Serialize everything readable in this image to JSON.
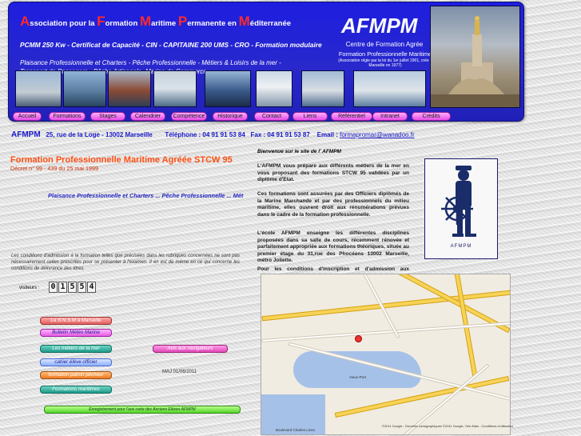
{
  "header": {
    "title_parts": [
      {
        "cap": "A",
        "rest": "ssociation pour la "
      },
      {
        "cap": "F",
        "rest": "ormation "
      },
      {
        "cap": "M",
        "rest": "aritime "
      },
      {
        "cap": "P",
        "rest": "ermanente en "
      },
      {
        "cap": "M",
        "rest": "éditerranée"
      }
    ],
    "subline": "PCMM 250 Kw - Certificat de Capacité - CIN - CAPITAINE 200 UMS - CRO - Formation modulaire",
    "sectors": "Plaisance Professionnelle et Charters - Pêche Professionnelle - Métiers & Loisirs de la mer - Transport de Passagers - Pêche Artisanale- Marine de Commerce",
    "brand": "AFMPM",
    "centre_line1": "Centre de Formation Agrée",
    "centre_line2": "Formation Professionnelle Maritime",
    "centre_line3": "(Association régie par la loi du 1er juillet 1901, crée à Marseille en 1977)"
  },
  "nav": [
    {
      "label": "Accueil"
    },
    {
      "label": "Formations"
    },
    {
      "label": "Stages"
    },
    {
      "label": "Calendrier"
    },
    {
      "label": "Compétence"
    },
    {
      "label": "Historique"
    },
    {
      "label": "Contact"
    },
    {
      "label": "Liens"
    },
    {
      "label": "Référentiel"
    },
    {
      "label": "Intranet"
    },
    {
      "label": "Crédits"
    }
  ],
  "contact": {
    "name": "AFMPM",
    "address": "25, rue de la Loge - 13002 Marseille",
    "phone": "Téléphone : 04 91 91 53 84",
    "fax": "Fax : 04 91 91 53 87",
    "email_label": "Email :",
    "email": "formapromar@wanadoo.fr"
  },
  "left": {
    "formation_title": "Formation Professionnelle Maritime Agréée STCW 95",
    "decret": "Décret n° 99 - 439 du 25 mai 1999",
    "marquee": "Plaisance Professionnelle et Charters ... Pêche Professionnelle ... Mét",
    "conditions": "Les conditions d'admission à la formation telles que précisées dans les rubriques concernées ne sont pas nécessairement celles prescrites pour se présenter à l'examen. Il en est de même en ce qui concerne les conditions de délivrance des titres.",
    "visitors_label": "visiteurs :",
    "visitor_digits": [
      "0",
      "1",
      "5",
      "5",
      "4"
    ],
    "links": [
      "La S.N.S.M à Marseille",
      "Bulletin Météo Marine",
      "Les métiers de la mer",
      "cahier élève officier",
      "formation patron pêcheur",
      "Formations maritimes",
      "Avis aux navigateurs",
      "Enregistrement pour l'ave carte des Anciens Elèves AFMPM"
    ],
    "maj": "MAJ 01/06/2011"
  },
  "right": {
    "welcome": "Bienvenue sur le site de l' AFMPM",
    "para1": "L'AFMPM vous prépare aux différents métiers de la mer en vous proposant des formations STCW 95 validées par un diplôme d'Etat.",
    "para2": "Ces formations sont assurées par des Officiers diplômés de la Marine Marchande et par des professionnels du milieu maritime, elles ouvrent droit aux rénumérations prévues dans le cadre de la formation professionnelle.",
    "para3": "L'école AFMPM enseigne les différentes disciplines proposées dans sa salle de cours, récemment rénovée et parfaitement appropriée aux formations théoriques, située au premier étage du 31,rue des Phocéens 13002 Marseille, métro Joliette.",
    "para4": "Pour les conditions d'inscription et d'admission aux formations, veuillez consulter la page Formations.",
    "logo_text": "AFMPM",
    "map_footer": "©2011 Google - Données cartographiques ©2011 Google, Tele Atlas - Conditions d'utilisation",
    "map_label_street": "Boulevard Charles Livon",
    "map_label_port": "Vieux-Port"
  },
  "colors": {
    "header_blue": "#2424d0",
    "accent_red": "#ff2a2a",
    "title_orange": "#ff4f12",
    "link_blue": "#1a1acc"
  }
}
